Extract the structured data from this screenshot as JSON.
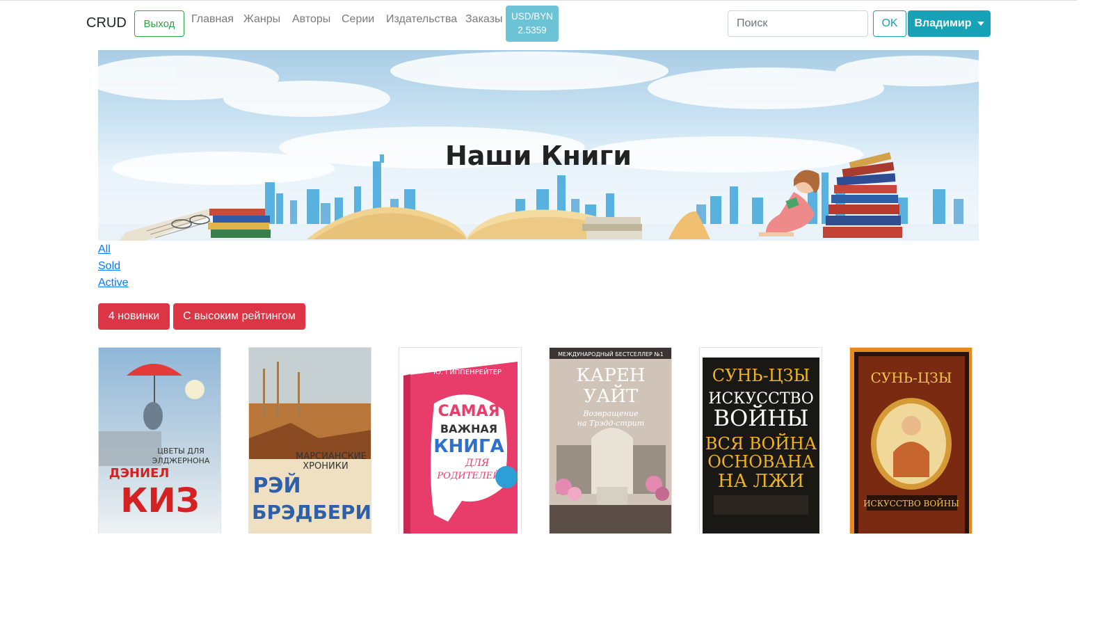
{
  "navbar": {
    "brand": "CRUD",
    "exit_label": "Выход",
    "links": [
      "Главная",
      "Жанры",
      "Авторы",
      "Серии",
      "Издательства",
      "Заказы"
    ],
    "rate": {
      "pair": "USD/BYN",
      "value": "2.5359"
    },
    "search_placeholder": "Поиск",
    "ok_label": "OK",
    "user_label": "Владимир"
  },
  "hero": {
    "title": "Наши Книги"
  },
  "filters": [
    "All",
    "Sold",
    "Active"
  ],
  "buttons": {
    "new4": "4 новинки",
    "high_rating": "С высоким рейтингом"
  },
  "books": [
    {
      "top": "ЦВЕТЫ ДЛЯ",
      "top2": "ЭЛДЖЕРНОНА",
      "author1": "ДЭНИЕЛ",
      "author2": "КИЗ"
    },
    {
      "top": "МАРСИАНСКИЕ",
      "top2": "ХРОНИКИ",
      "author1": "РЭЙ",
      "author2": "БРЭДБЕРИ"
    },
    {
      "author": "Ю. ГИППЕНРЕЙТЕР",
      "t1": "САМАЯ",
      "t2": "ВАЖНАЯ",
      "t3": "КНИГА",
      "t4": "ДЛЯ",
      "t5": "РОДИТЕЛЕЙ"
    },
    {
      "header": "МЕЖДУНАРОДНЫЙ БЕСТСЕЛЛЕР №1",
      "a1": "КАРЕН",
      "a2": "УАЙТ",
      "s1": "Возвращение",
      "s2": "на Трэдд-стрит"
    },
    {
      "a": "СУНЬ-ЦЗЫ",
      "t1": "ИСКУССТВО",
      "t2": "ВОЙНЫ",
      "q1": "ВСЯ ВОЙНА",
      "q2": "ОСНОВАНА",
      "q3": "НА ЛЖИ"
    },
    {
      "a": "СУНЬ-ЦЗЫ",
      "t": "ИСКУССТВО ВОЙНЫ"
    }
  ]
}
